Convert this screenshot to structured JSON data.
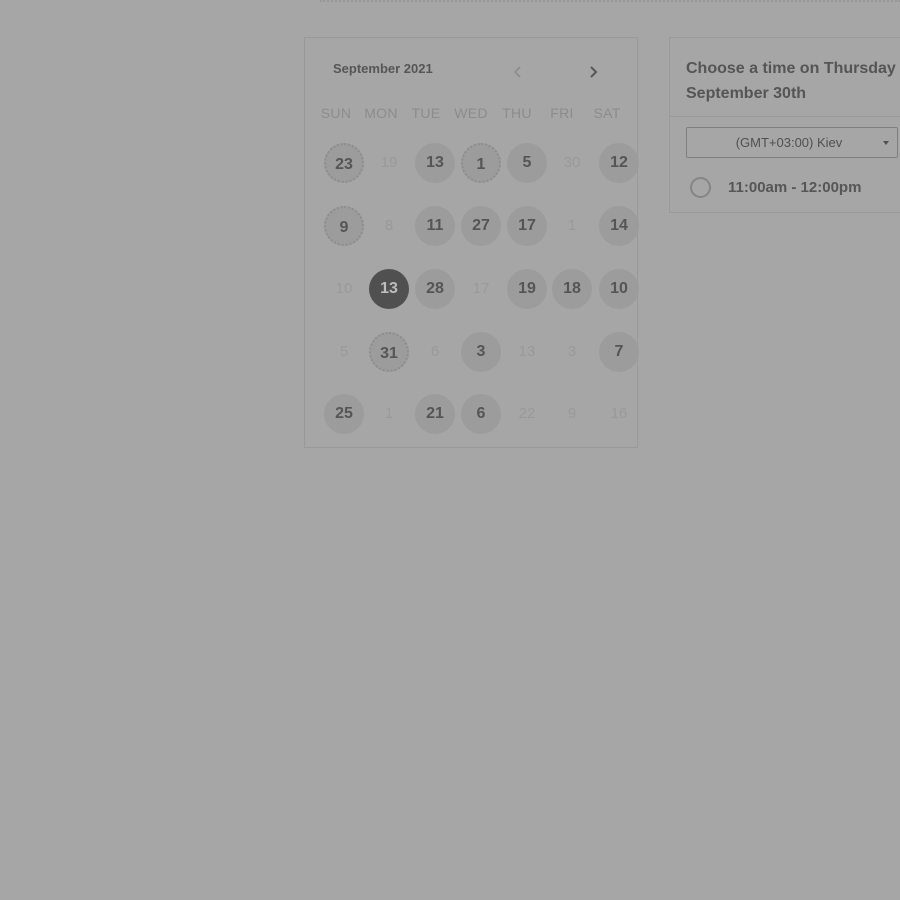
{
  "calendar": {
    "month_label": "September 2021",
    "prev_icon": "chevron-left-icon",
    "next_icon": "chevron-right-icon",
    "weekdays": [
      "SUN",
      "MON",
      "TUE",
      "WED",
      "THU",
      "FRI",
      "SAT"
    ],
    "weeks": [
      [
        {
          "label": "23",
          "state": "available"
        },
        {
          "label": "19",
          "state": "unavailable"
        },
        {
          "label": "13",
          "state": "available"
        },
        {
          "label": "1",
          "state": "available"
        },
        {
          "label": "5",
          "state": "available"
        },
        {
          "label": "30",
          "state": "unavailable"
        },
        {
          "label": "12",
          "state": "available"
        }
      ],
      [
        {
          "label": "9",
          "state": "available"
        },
        {
          "label": "8",
          "state": "unavailable"
        },
        {
          "label": "11",
          "state": "available"
        },
        {
          "label": "27",
          "state": "available"
        },
        {
          "label": "17",
          "state": "available"
        },
        {
          "label": "1",
          "state": "unavailable"
        },
        {
          "label": "14",
          "state": "available"
        }
      ],
      [
        {
          "label": "10",
          "state": "unavailable"
        },
        {
          "label": "13",
          "state": "selected"
        },
        {
          "label": "28",
          "state": "available"
        },
        {
          "label": "17",
          "state": "unavailable"
        },
        {
          "label": "19",
          "state": "available"
        },
        {
          "label": "18",
          "state": "available"
        },
        {
          "label": "10",
          "state": "available"
        }
      ],
      [
        {
          "label": "5",
          "state": "unavailable"
        },
        {
          "label": "31",
          "state": "available"
        },
        {
          "label": "6",
          "state": "unavailable"
        },
        {
          "label": "3",
          "state": "available"
        },
        {
          "label": "13",
          "state": "unavailable"
        },
        {
          "label": "3",
          "state": "unavailable"
        },
        {
          "label": "7",
          "state": "available"
        }
      ],
      [
        {
          "label": "25",
          "state": "available"
        },
        {
          "label": "1",
          "state": "unavailable"
        },
        {
          "label": "21",
          "state": "available"
        },
        {
          "label": "6",
          "state": "available"
        },
        {
          "label": "22",
          "state": "unavailable"
        },
        {
          "label": "9",
          "state": "unavailable"
        },
        {
          "label": "16",
          "state": "unavailable"
        }
      ]
    ]
  },
  "time_panel": {
    "title": "Choose a time on Thursday September 30th",
    "timezone": "(GMT+03:00) Kiev",
    "caret_icon": "caret-down-icon",
    "slots": [
      {
        "label": "11:00am - 12:00pm",
        "selected": false
      }
    ]
  },
  "colors": {
    "background": "#a6a6a6",
    "selected_day": "#505050",
    "available_day": "#9c9c9c"
  }
}
